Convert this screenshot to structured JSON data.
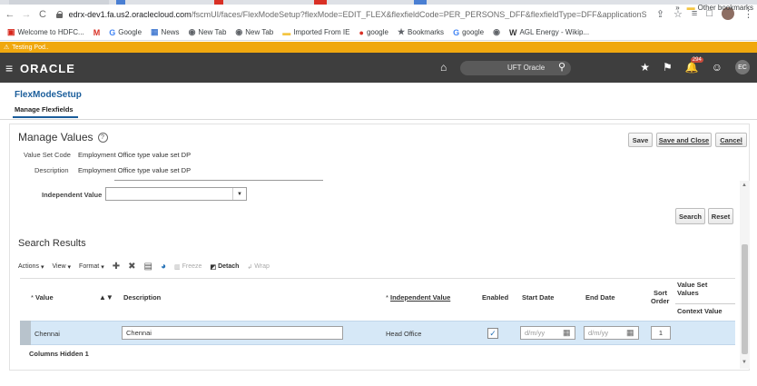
{
  "browser": {
    "url_host": "edrx-dev1.fa.us2.oraclecloud.com",
    "url_path": "/fscmUI/faces/FlexModeSetup?flexMode=EDIT_FLEX&flexfieldCode=PER_PERSONS_DFF&flexfieldType=DFF&applicationShortNa..."
  },
  "bookmarks": [
    {
      "icon": "hdfc-icon",
      "glyph": "▣",
      "color": "#d7261b",
      "label": "Welcome to HDFC..."
    },
    {
      "icon": "gmail-icon",
      "glyph": "M",
      "color": "#d93025",
      "label": ""
    },
    {
      "icon": "google-icon",
      "glyph": "G",
      "color": "#4285f4",
      "label": "Google"
    },
    {
      "icon": "news-icon",
      "glyph": "▦",
      "color": "#4a7fd3",
      "label": "News"
    },
    {
      "icon": "globe-icon",
      "glyph": "◉",
      "color": "#5f6368",
      "label": "New Tab"
    },
    {
      "icon": "globe-icon",
      "glyph": "◉",
      "color": "#5f6368",
      "label": "New Tab"
    },
    {
      "icon": "folder-icon",
      "glyph": "▬",
      "color": "#f4c542",
      "label": "Imported From IE"
    },
    {
      "icon": "opera-icon",
      "glyph": "●",
      "color": "#d93025",
      "label": "google"
    },
    {
      "icon": "star-icon",
      "glyph": "★",
      "color": "#5f6368",
      "label": "Bookmarks"
    },
    {
      "icon": "google-icon",
      "glyph": "G",
      "color": "#4285f4",
      "label": "google"
    },
    {
      "icon": "globe-icon",
      "glyph": "◉",
      "color": "#5f6368",
      "label": ""
    },
    {
      "icon": "wiki-icon",
      "glyph": "W",
      "color": "#333333",
      "label": "AGL Energy - Wikip..."
    }
  ],
  "bookmarks_right": {
    "more": "»",
    "other": "Other bookmarks"
  },
  "pod_bar": {
    "label": "Testing Pod.."
  },
  "header": {
    "logo": "ORACLE",
    "search_placeholder": "UFT Oracle",
    "notification_count": "294",
    "avatar_initials": "EC"
  },
  "page": {
    "title": "FlexModeSetup",
    "subtab": "Manage Flexfields"
  },
  "manage_values": {
    "heading": "Manage Values",
    "save_label": "Save",
    "save_close_label": "Save and Close",
    "cancel_label": "Cancel",
    "value_set_code_label": "Value Set Code",
    "value_set_code": "Employment Office type value set DP",
    "description_label": "Description",
    "description": "Employment Office type value set DP",
    "independent_value_label": "Independent Value",
    "independent_value": "",
    "search_label": "Search",
    "reset_label": "Reset"
  },
  "search_results": {
    "heading": "Search Results",
    "toolbar": {
      "actions": "Actions",
      "view": "View",
      "format": "Format",
      "freeze": "Freeze",
      "detach": "Detach",
      "wrap": "Wrap"
    },
    "columns": {
      "value": "Value",
      "description": "Description",
      "independent_value": "Independent Value",
      "enabled": "Enabled",
      "start_date": "Start Date",
      "end_date": "End Date",
      "sort_order_1": "Sort",
      "sort_order_2": "Order",
      "value_set_values_1": "Value Set",
      "value_set_values_2": "Values",
      "context_value": "Context Value"
    },
    "rows": [
      {
        "value": "Chennai",
        "description": "Chennai",
        "independent_value": "Head Office",
        "enabled": true,
        "start_date_placeholder": "d/m/yy",
        "end_date_placeholder": "d/m/yy",
        "sort_order": "1"
      }
    ],
    "columns_hidden": "Columns Hidden 1"
  }
}
